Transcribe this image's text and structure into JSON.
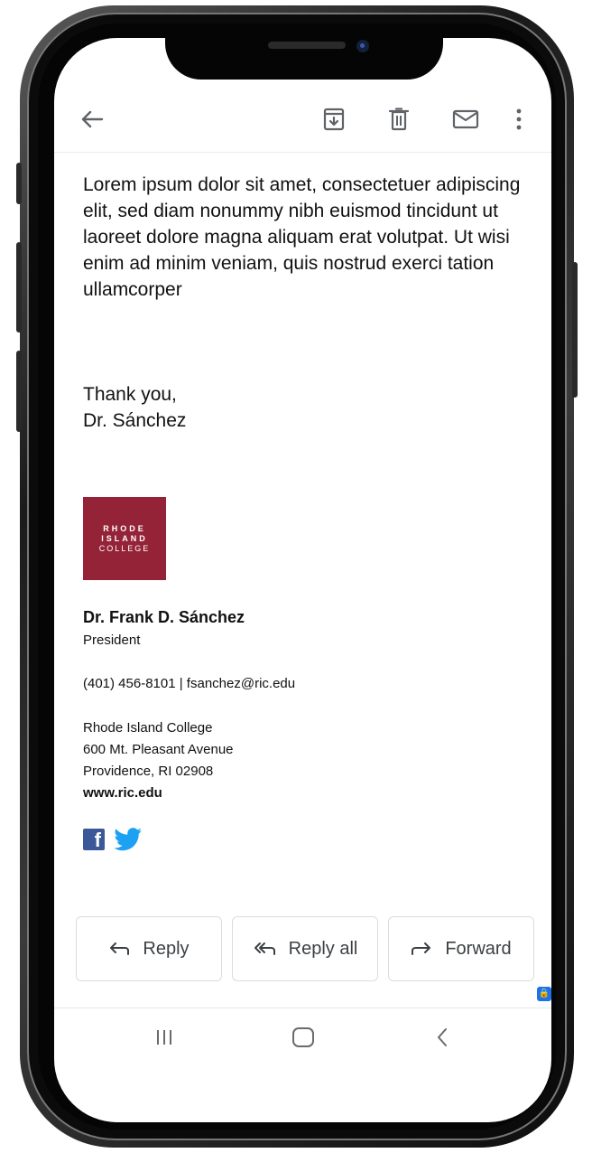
{
  "toolbar": {
    "back_icon": "arrow-back-icon",
    "archive_icon": "archive-icon",
    "delete_icon": "trash-icon",
    "mark_unread_icon": "mail-icon",
    "more_icon": "more-vert-icon"
  },
  "message": {
    "body": "Lorem ipsum dolor sit amet, consectetuer adipiscing elit, sed diam nonummy nibh euismod tincidunt ut laoreet dolore magna aliquam erat volutpat. Ut wisi enim ad minim veniam, quis nostrud exerci tation ullamcorper",
    "signoff_line1": "Thank you,",
    "signoff_line2": "Dr. Sánchez"
  },
  "signature": {
    "logo_line1": "RHODE",
    "logo_line2": "ISLAND",
    "logo_line3": "COLLEGE",
    "logo_color": "#952337",
    "name": "Dr. Frank D. Sánchez",
    "title": "President",
    "contact": "(401) 456-8101 | fsanchez@ric.edu",
    "org": "Rhode Island College",
    "street": "600 Mt. Pleasant Avenue",
    "city": "Providence, RI 02908",
    "website": "www.ric.edu",
    "social": [
      "facebook-icon",
      "twitter-icon"
    ]
  },
  "actions": {
    "reply": "Reply",
    "reply_all": "Reply all",
    "forward": "Forward"
  },
  "navbar": [
    "recents-icon",
    "home-icon",
    "back-icon"
  ]
}
